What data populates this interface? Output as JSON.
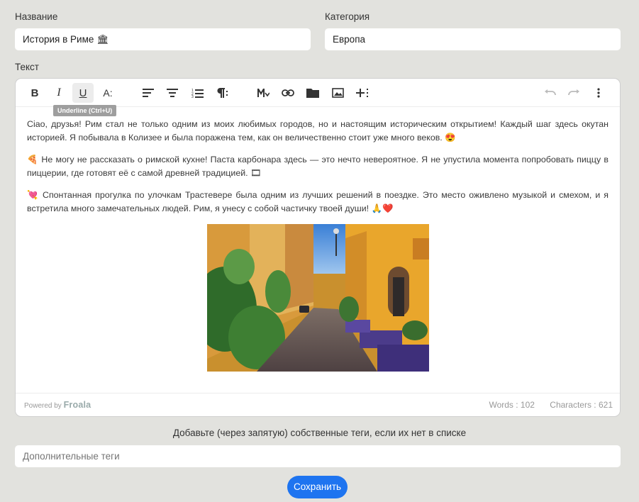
{
  "form": {
    "title_label": "Название",
    "title_value": "История в Риме 🏛",
    "category_label": "Категория",
    "category_value": "Европа",
    "text_label": "Текст"
  },
  "editor": {
    "toolbar": {
      "bold": "B",
      "italic": "I",
      "underline": "U",
      "font_size": "A:",
      "tooltip": "Underline (Ctrl+U)"
    },
    "paragraphs": [
      "Ciao, друзья! Рим стал не только одним из моих любимых городов, но и настоящим историческим открытием! Каждый шаг здесь окутан историей. Я побывала в Колизее и была поражена тем, как он величественно стоит уже много веков. 😍",
      "🍕 Не могу не рассказать о римской кухне! Паста карбонара здесь — это нечто невероятное. Я не упустила момента попробовать пиццу в пиццерии, где готовят её с самой древней традицией. 🎞",
      "💘 Спонтанная прогулка по улочкам Трастевере была одним из лучших решений в поездке. Это место оживлено музыкой и смехом, и я встретила много замечательных людей. Рим, я унесу с собой частичку твоей души! 🙏❤️"
    ],
    "powered_by": "Powered by",
    "brand": "Froala",
    "words": "Words : 102",
    "characters": "Characters : 621"
  },
  "tags": {
    "hint": "Добавьте (через запятую) собственные теги, если их нет в списке",
    "placeholder": "Дополнительные теги"
  },
  "save_label": "Сохранить",
  "colors": {
    "accent": "#1e74f0",
    "background": "#e2e2de"
  }
}
